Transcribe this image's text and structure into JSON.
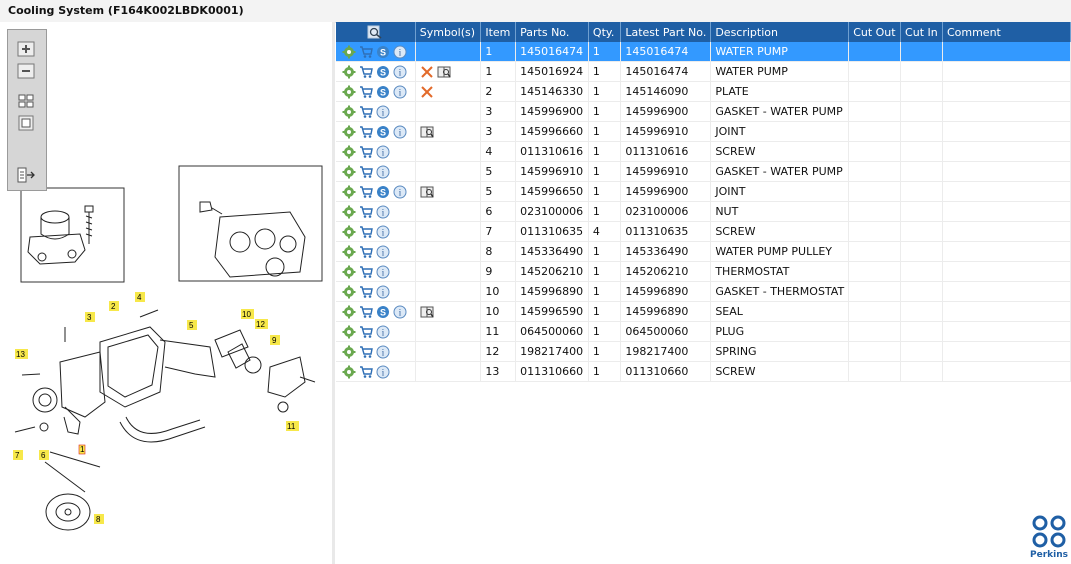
{
  "window": {
    "title": "Cooling System (F164K002LBDK0001)"
  },
  "toolbar": {
    "buttons": [
      "zoom-in",
      "zoom-out",
      "fit-page",
      "actual-size",
      "export"
    ]
  },
  "diagram": {
    "callouts": [
      "1",
      "2",
      "3",
      "4",
      "5",
      "6",
      "7",
      "8",
      "9",
      "10",
      "11",
      "12",
      "13"
    ]
  },
  "table": {
    "columns": {
      "search": "",
      "symbols": "Symbol(s)",
      "item": "Item",
      "parts_no": "Parts No.",
      "qty": "Qty.",
      "latest": "Latest Part No.",
      "description": "Description",
      "cut_out": "Cut Out",
      "cut_in": "Cut In",
      "comment": "Comment"
    },
    "selected_row": 0,
    "rows": [
      {
        "item": "1",
        "parts_no": "145016474",
        "qty": "1",
        "latest": "145016474",
        "description": "WATER PUMP",
        "s_icon": true,
        "symbols": []
      },
      {
        "item": "1",
        "parts_no": "145016924",
        "qty": "1",
        "latest": "145016474",
        "description": "WATER PUMP",
        "s_icon": true,
        "symbols": [
          "cross",
          "book"
        ]
      },
      {
        "item": "2",
        "parts_no": "145146330",
        "qty": "1",
        "latest": "145146090",
        "description": "PLATE",
        "s_icon": true,
        "symbols": [
          "cross"
        ]
      },
      {
        "item": "3",
        "parts_no": "145996900",
        "qty": "1",
        "latest": "145996900",
        "description": "GASKET - WATER PUMP",
        "s_icon": false,
        "symbols": []
      },
      {
        "item": "3",
        "parts_no": "145996660",
        "qty": "1",
        "latest": "145996910",
        "description": "JOINT",
        "s_icon": true,
        "symbols": [
          "book"
        ]
      },
      {
        "item": "4",
        "parts_no": "011310616",
        "qty": "1",
        "latest": "011310616",
        "description": "SCREW",
        "s_icon": false,
        "symbols": []
      },
      {
        "item": "5",
        "parts_no": "145996910",
        "qty": "1",
        "latest": "145996910",
        "description": "GASKET - WATER PUMP",
        "s_icon": false,
        "symbols": []
      },
      {
        "item": "5",
        "parts_no": "145996650",
        "qty": "1",
        "latest": "145996900",
        "description": "JOINT",
        "s_icon": true,
        "symbols": [
          "book"
        ]
      },
      {
        "item": "6",
        "parts_no": "023100006",
        "qty": "1",
        "latest": "023100006",
        "description": "NUT",
        "s_icon": false,
        "symbols": []
      },
      {
        "item": "7",
        "parts_no": "011310635",
        "qty": "4",
        "latest": "011310635",
        "description": "SCREW",
        "s_icon": false,
        "symbols": []
      },
      {
        "item": "8",
        "parts_no": "145336490",
        "qty": "1",
        "latest": "145336490",
        "description": "WATER PUMP PULLEY",
        "s_icon": false,
        "symbols": []
      },
      {
        "item": "9",
        "parts_no": "145206210",
        "qty": "1",
        "latest": "145206210",
        "description": "THERMOSTAT",
        "s_icon": false,
        "symbols": []
      },
      {
        "item": "10",
        "parts_no": "145996890",
        "qty": "1",
        "latest": "145996890",
        "description": "GASKET - THERMOSTAT",
        "s_icon": false,
        "symbols": []
      },
      {
        "item": "10",
        "parts_no": "145996590",
        "qty": "1",
        "latest": "145996890",
        "description": "SEAL",
        "s_icon": true,
        "symbols": [
          "book"
        ]
      },
      {
        "item": "11",
        "parts_no": "064500060",
        "qty": "1",
        "latest": "064500060",
        "description": "PLUG",
        "s_icon": false,
        "symbols": []
      },
      {
        "item": "12",
        "parts_no": "198217400",
        "qty": "1",
        "latest": "198217400",
        "description": "SPRING",
        "s_icon": false,
        "symbols": []
      },
      {
        "item": "13",
        "parts_no": "011310660",
        "qty": "1",
        "latest": "011310660",
        "description": "SCREW",
        "s_icon": false,
        "symbols": []
      }
    ]
  },
  "brand": {
    "name": "Perkins",
    "color": "#1f5fa5",
    "header_color": "#1f5fa5",
    "selected_color": "#3399ff"
  }
}
